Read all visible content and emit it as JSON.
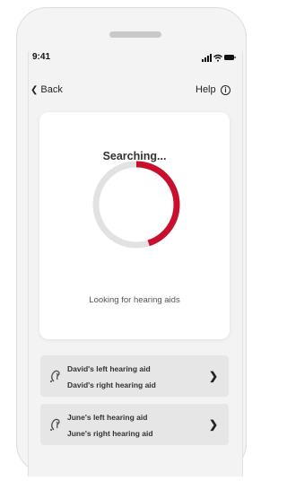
{
  "status_bar": {
    "time": "9:41"
  },
  "nav": {
    "back_label": "Back",
    "help_label": "Help",
    "help_icon": "info-icon"
  },
  "search_card": {
    "title": "Searching...",
    "subtitle": "Looking for hearing aids",
    "progress_fraction": 0.45,
    "accent_color": "#c8102e",
    "track_color": "#e2e2e2"
  },
  "devices": [
    {
      "icon": "hearing-aid-icon",
      "left_label": "David's left hearing aid",
      "right_label": "David's right hearing aid"
    },
    {
      "icon": "hearing-aid-icon",
      "left_label": "June's left hearing aid",
      "right_label": "June's right hearing aid"
    }
  ]
}
